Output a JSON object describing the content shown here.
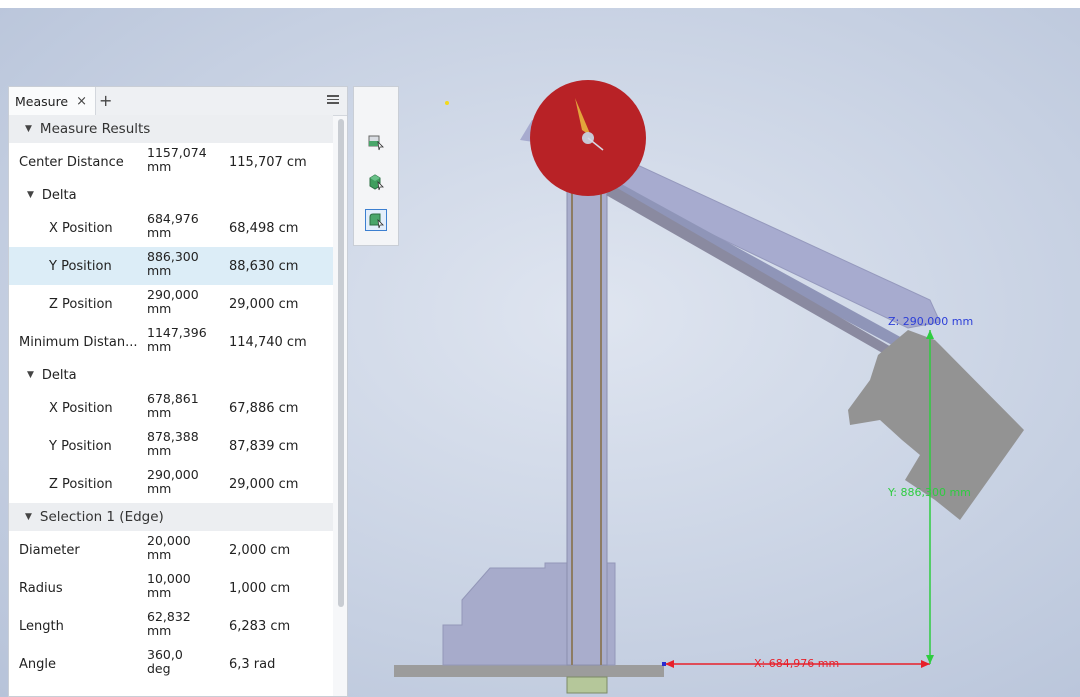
{
  "panel": {
    "tab_label": "Measure",
    "tab_close": "×",
    "add_tab": "+",
    "sections": {
      "measure_results": "Measure Results",
      "selection1": "Selection 1 (Edge)"
    },
    "rows": [
      {
        "label": "Center Distance",
        "mm": "1157,074 mm",
        "cm": "115,707 cm"
      },
      {
        "label": "X Position",
        "mm": "684,976 mm",
        "cm": "68,498 cm"
      },
      {
        "label": "Y Position",
        "mm": "886,300 mm",
        "cm": "88,630 cm"
      },
      {
        "label": "Z Position",
        "mm": "290,000 mm",
        "cm": "29,000 cm"
      },
      {
        "label": "Minimum Distan...",
        "mm": "1147,396 mm",
        "cm": "114,740 cm"
      },
      {
        "label": "X Position",
        "mm": "678,861 mm",
        "cm": "67,886 cm"
      },
      {
        "label": "Y Position",
        "mm": "878,388 mm",
        "cm": "87,839 cm"
      },
      {
        "label": "Z Position",
        "mm": "290,000 mm",
        "cm": "29,000 cm"
      },
      {
        "label": "Diameter",
        "mm": "20,000 mm",
        "cm": "2,000 cm"
      },
      {
        "label": "Radius",
        "mm": "10,000 mm",
        "cm": "1,000 cm"
      },
      {
        "label": "Length",
        "mm": "62,832 mm",
        "cm": "6,283 cm"
      },
      {
        "label": "Angle",
        "mm": "360,0 deg",
        "cm": "6,3 rad"
      }
    ],
    "delta_label": "Delta"
  },
  "viewport": {
    "dim_x": "X: 684,976 mm",
    "dim_y": "Y: 886,300 mm",
    "dim_z": "Z: 290,000 mm"
  },
  "colors": {
    "dim_x": "#e8202a",
    "dim_y": "#2ecc40",
    "dim_z": "#2d3fd8",
    "model_blue": "#a8accd",
    "model_gray": "#959595",
    "disc_red": "#b82226"
  }
}
